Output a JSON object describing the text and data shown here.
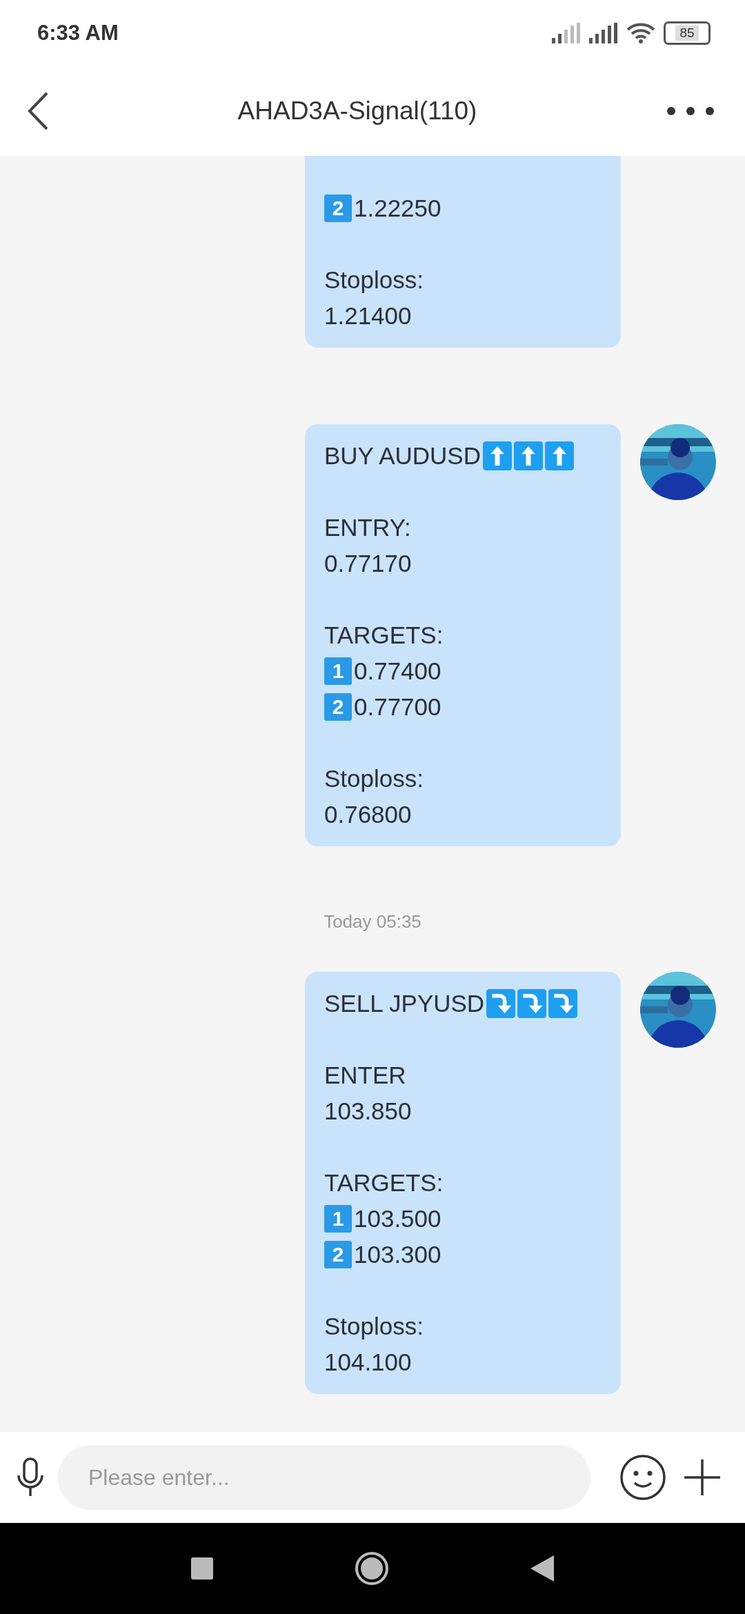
{
  "status_bar": {
    "time": "6:33 AM",
    "battery": "85"
  },
  "header": {
    "title": "AHAD3A-Signal(110)"
  },
  "chat": [
    {
      "kind": "message",
      "lines": [
        {
          "kind": "keycap",
          "key": "2",
          "text": "1.22250"
        },
        {
          "kind": "blank"
        },
        {
          "kind": "text",
          "text": "Stoploss:"
        },
        {
          "kind": "text",
          "text": "1.21400"
        }
      ]
    },
    {
      "kind": "message",
      "avatar": true,
      "lines": [
        {
          "kind": "title",
          "text": "BUY AUDUSD",
          "signs": [
            {
              "kind": "up"
            },
            {
              "kind": "up"
            },
            {
              "kind": "up"
            }
          ]
        },
        {
          "kind": "blank"
        },
        {
          "kind": "text",
          "text": "ENTRY:"
        },
        {
          "kind": "text",
          "text": "0.77170"
        },
        {
          "kind": "blank"
        },
        {
          "kind": "text",
          "text": "TARGETS:"
        },
        {
          "kind": "keycap",
          "key": "1",
          "text": "0.77400"
        },
        {
          "kind": "keycap",
          "key": "2",
          "text": "0.77700"
        },
        {
          "kind": "blank"
        },
        {
          "kind": "text",
          "text": "Stoploss:"
        },
        {
          "kind": "text",
          "text": "0.76800"
        }
      ]
    },
    {
      "kind": "time",
      "text": "Today 05:35"
    },
    {
      "kind": "message",
      "avatar": true,
      "lines": [
        {
          "kind": "title",
          "text": "SELL JPYUSD",
          "signs": [
            {
              "kind": "down"
            },
            {
              "kind": "down"
            },
            {
              "kind": "down"
            }
          ]
        },
        {
          "kind": "blank"
        },
        {
          "kind": "text",
          "text": "ENTER"
        },
        {
          "kind": "text",
          "text": "103.850"
        },
        {
          "kind": "blank"
        },
        {
          "kind": "text",
          "text": "TARGETS:"
        },
        {
          "kind": "keycap",
          "key": "1",
          "text": "103.500"
        },
        {
          "kind": "keycap",
          "key": "2",
          "text": "103.300"
        },
        {
          "kind": "blank"
        },
        {
          "kind": "text",
          "text": "Stoploss:"
        },
        {
          "kind": "text",
          "text": "104.100"
        }
      ]
    }
  ],
  "composer": {
    "placeholder": "Please enter..."
  }
}
